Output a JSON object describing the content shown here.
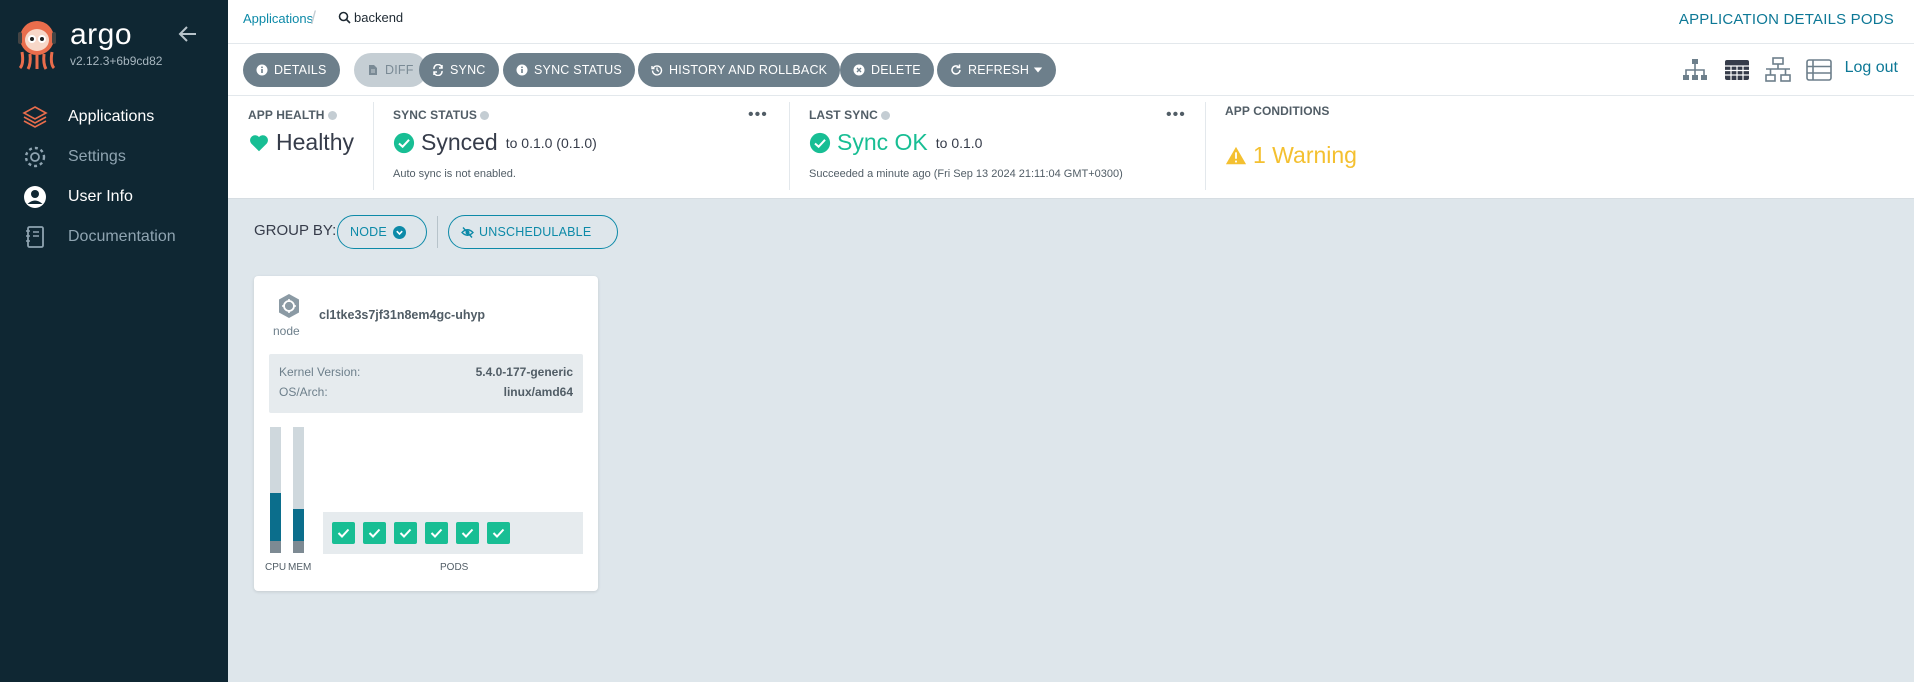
{
  "sidebar": {
    "brand": "argo",
    "version": "v2.12.3+6b9cd82",
    "items": [
      {
        "label": "Applications"
      },
      {
        "label": "Settings"
      },
      {
        "label": "User Info"
      },
      {
        "label": "Documentation"
      }
    ]
  },
  "topbar": {
    "breadcrumb_link": "Applications",
    "search_text": "backend",
    "right_title": "APPLICATION DETAILS PODS"
  },
  "toolbar": {
    "buttons": [
      {
        "label": "DETAILS",
        "icon": "info-icon"
      },
      {
        "label": "DIFF",
        "icon": "file-icon"
      },
      {
        "label": "SYNC",
        "icon": "sync-icon"
      },
      {
        "label": "SYNC STATUS",
        "icon": "info-icon"
      },
      {
        "label": "HISTORY AND ROLLBACK",
        "icon": "history-icon"
      },
      {
        "label": "DELETE",
        "icon": "delete-icon"
      },
      {
        "label": "REFRESH",
        "icon": "refresh-icon"
      }
    ],
    "logout": "Log out"
  },
  "status": {
    "health": {
      "title": "APP HEALTH",
      "value": "Healthy"
    },
    "sync": {
      "title": "SYNC STATUS",
      "value": "Synced",
      "to": "to 0.1.0 (0.1.0)",
      "note": "Auto sync is not enabled."
    },
    "last_sync": {
      "title": "LAST SYNC",
      "value": "Sync OK",
      "to": "to 0.1.0",
      "note": "Succeeded a minute ago (Fri Sep 13 2024 21:11:04 GMT+0300)"
    },
    "conditions": {
      "title": "APP CONDITIONS",
      "value": "1 Warning"
    }
  },
  "groupby": {
    "label": "GROUP BY:",
    "node_button": "NODE",
    "unschedulable_button": "UNSCHEDULABLE"
  },
  "node": {
    "type_label": "node",
    "name": "cl1tke3s7jf31n8em4gc-uhyp",
    "kernel_label": "Kernel Version:",
    "kernel_value": "5.4.0-177-generic",
    "os_label": "OS/Arch:",
    "os_value": "linux/amd64",
    "cpu_label": "CPU",
    "mem_label": "MEM",
    "cpu_usage_fraction": 0.42,
    "mem_usage_fraction": 0.28,
    "pods_label": "PODS",
    "pod_count": 6
  },
  "colors": {
    "sidebar_bg": "#0f2733",
    "accent": "#0d8aa8",
    "healthy": "#18be94",
    "warning": "#f4c030",
    "button_bg": "#6d7f8b"
  }
}
